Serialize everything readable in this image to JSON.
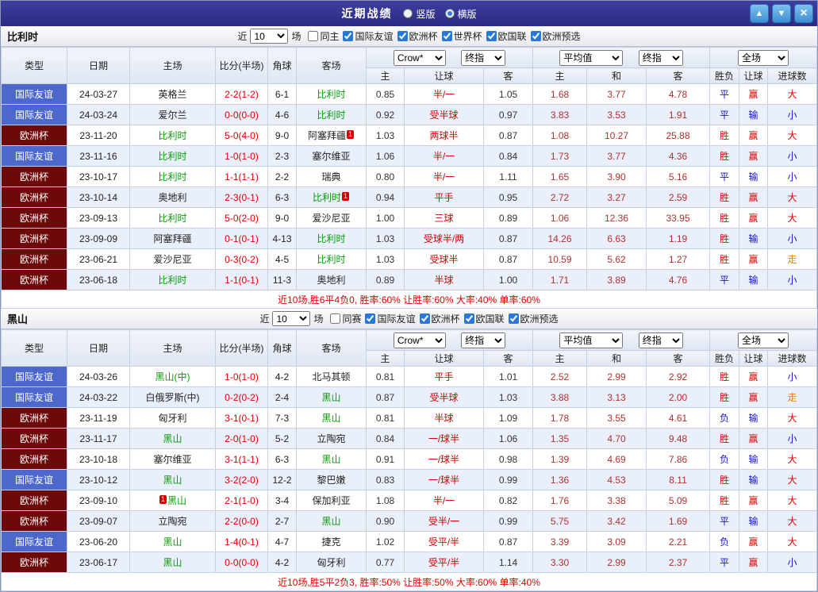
{
  "topbar": {
    "title": "近期战绩",
    "radios": [
      {
        "label": "竖版",
        "selected": false
      },
      {
        "label": "横版",
        "selected": true
      }
    ],
    "up_icon": "▲",
    "down_icon": "▼",
    "close_icon": "×"
  },
  "labels": {
    "near": "近",
    "games": "场"
  },
  "columns": {
    "type": "类型",
    "date": "日期",
    "home": "主场",
    "score": "比分(半场)",
    "corner": "角球",
    "away": "客场",
    "ah_home": "主",
    "ah_line": "让球",
    "ah_away": "客",
    "eu_home": "主",
    "eu_draw": "和",
    "eu_away": "客",
    "result": "胜负",
    "ah_result": "让球",
    "goals": "进球数"
  },
  "selects": {
    "bookmaker": "Crow*",
    "final_a": "终指",
    "average": "平均值",
    "final_b": "终指",
    "fulltime": "全场"
  },
  "colors": {
    "titlebar": "#32328e",
    "friendly_type": "#4d68cc",
    "eurocup_type": "#6e0909",
    "highlight_team_green": "#0a9b0a",
    "win_red": "#e00000",
    "lose_blue": "#1515cc",
    "push_orange": "#dd8800"
  },
  "sections": [
    {
      "team": "比利时",
      "count": "10",
      "filters": [
        {
          "label": "同主",
          "checked": false
        },
        {
          "label": "国际友谊",
          "checked": true
        },
        {
          "label": "欧洲杯",
          "checked": true
        },
        {
          "label": "世界杯",
          "checked": true
        },
        {
          "label": "欧国联",
          "checked": true
        },
        {
          "label": "欧洲预选",
          "checked": true
        }
      ],
      "rows": [
        {
          "type": "国际友谊",
          "type_cls": "friendly",
          "date": "24-03-27",
          "home": "英格兰",
          "home_hl": false,
          "score": "2-2(1-2)",
          "corner": "6-1",
          "away": "比利时",
          "away_hl": true,
          "ah": [
            "0.85",
            "半/一",
            "1.05"
          ],
          "eu": [
            "1.68",
            "3.77",
            "4.78"
          ],
          "res": [
            "平",
            "赢",
            "大"
          ]
        },
        {
          "type": "国际友谊",
          "type_cls": "friendly",
          "date": "24-03-24",
          "home": "爱尔兰",
          "home_hl": false,
          "score": "0-0(0-0)",
          "corner": "4-6",
          "away": "比利时",
          "away_hl": true,
          "ah": [
            "0.92",
            "受半球",
            "0.97"
          ],
          "eu": [
            "3.83",
            "3.53",
            "1.91"
          ],
          "res": [
            "平",
            "输",
            "小"
          ]
        },
        {
          "type": "欧洲杯",
          "type_cls": "euro",
          "date": "23-11-20",
          "home": "比利时",
          "home_hl": true,
          "score": "5-0(4-0)",
          "corner": "9-0",
          "away": "阿塞拜疆",
          "away_hl": false,
          "away_badge": "1",
          "away_badge_pos": "post",
          "ah": [
            "1.03",
            "两球半",
            "0.87"
          ],
          "eu": [
            "1.08",
            "10.27",
            "25.88"
          ],
          "res": [
            "胜",
            "赢",
            "大"
          ]
        },
        {
          "type": "国际友谊",
          "type_cls": "friendly",
          "date": "23-11-16",
          "home": "比利时",
          "home_hl": true,
          "score": "1-0(1-0)",
          "corner": "2-3",
          "away": "塞尔维亚",
          "away_hl": false,
          "ah": [
            "1.06",
            "半/一",
            "0.84"
          ],
          "eu": [
            "1.73",
            "3.77",
            "4.36"
          ],
          "res": [
            "胜",
            "赢",
            "小"
          ]
        },
        {
          "type": "欧洲杯",
          "type_cls": "euro",
          "date": "23-10-17",
          "home": "比利时",
          "home_hl": true,
          "score": "1-1(1-1)",
          "corner": "2-2",
          "away": "瑞典",
          "away_hl": false,
          "ah": [
            "0.80",
            "半/一",
            "1.11"
          ],
          "eu": [
            "1.65",
            "3.90",
            "5.16"
          ],
          "res": [
            "平",
            "输",
            "小"
          ]
        },
        {
          "type": "欧洲杯",
          "type_cls": "euro",
          "date": "23-10-14",
          "home": "奥地利",
          "home_hl": false,
          "score": "2-3(0-1)",
          "corner": "6-3",
          "away": "比利时",
          "away_hl": true,
          "away_badge": "1",
          "away_badge_pos": "post",
          "ah": [
            "0.94",
            "平手",
            "0.95"
          ],
          "eu": [
            "2.72",
            "3.27",
            "2.59"
          ],
          "res": [
            "胜",
            "赢",
            "大"
          ]
        },
        {
          "type": "欧洲杯",
          "type_cls": "euro",
          "date": "23-09-13",
          "home": "比利时",
          "home_hl": true,
          "score": "5-0(2-0)",
          "corner": "9-0",
          "away": "爱沙尼亚",
          "away_hl": false,
          "ah": [
            "1.00",
            "三球",
            "0.89"
          ],
          "eu": [
            "1.06",
            "12.36",
            "33.95"
          ],
          "res": [
            "胜",
            "赢",
            "大"
          ]
        },
        {
          "type": "欧洲杯",
          "type_cls": "euro",
          "date": "23-09-09",
          "home": "阿塞拜疆",
          "home_hl": false,
          "score": "0-1(0-1)",
          "corner": "4-13",
          "away": "比利时",
          "away_hl": true,
          "ah": [
            "1.03",
            "受球半/两",
            "0.87"
          ],
          "eu": [
            "14.26",
            "6.63",
            "1.19"
          ],
          "res": [
            "胜",
            "输",
            "小"
          ]
        },
        {
          "type": "欧洲杯",
          "type_cls": "euro",
          "date": "23-06-21",
          "home": "爱沙尼亚",
          "home_hl": false,
          "score": "0-3(0-2)",
          "corner": "4-5",
          "away": "比利时",
          "away_hl": true,
          "ah": [
            "1.03",
            "受球半",
            "0.87"
          ],
          "eu": [
            "10.59",
            "5.62",
            "1.27"
          ],
          "res": [
            "胜",
            "赢",
            "走"
          ]
        },
        {
          "type": "欧洲杯",
          "type_cls": "euro",
          "date": "23-06-18",
          "home": "比利时",
          "home_hl": true,
          "score": "1-1(0-1)",
          "corner": "11-3",
          "away": "奥地利",
          "away_hl": false,
          "ah": [
            "0.89",
            "半球",
            "1.00"
          ],
          "eu": [
            "1.71",
            "3.89",
            "4.76"
          ],
          "res": [
            "平",
            "输",
            "小"
          ]
        }
      ],
      "summary": "近10场,胜6平4负0, 胜率:60% 让胜率:60% 大率:40% 单率:60%"
    },
    {
      "team": "黑山",
      "count": "10",
      "filters": [
        {
          "label": "同赛",
          "checked": false
        },
        {
          "label": "国际友谊",
          "checked": true
        },
        {
          "label": "欧洲杯",
          "checked": true
        },
        {
          "label": "欧国联",
          "checked": true
        },
        {
          "label": "欧洲预选",
          "checked": true
        }
      ],
      "rows": [
        {
          "type": "国际友谊",
          "type_cls": "friendly",
          "date": "24-03-26",
          "home": "黑山(中)",
          "home_hl": true,
          "score": "1-0(1-0)",
          "corner": "4-2",
          "away": "北马其顿",
          "away_hl": false,
          "ah": [
            "0.81",
            "平手",
            "1.01"
          ],
          "eu": [
            "2.52",
            "2.99",
            "2.92"
          ],
          "res": [
            "胜",
            "赢",
            "小"
          ]
        },
        {
          "type": "国际友谊",
          "type_cls": "friendly",
          "date": "24-03-22",
          "home": "白俄罗斯(中)",
          "home_hl": false,
          "score": "0-2(0-2)",
          "corner": "2-4",
          "away": "黑山",
          "away_hl": true,
          "ah": [
            "0.87",
            "受半球",
            "1.03"
          ],
          "eu": [
            "3.88",
            "3.13",
            "2.00"
          ],
          "res": [
            "胜",
            "赢",
            "走"
          ]
        },
        {
          "type": "欧洲杯",
          "type_cls": "euro",
          "date": "23-11-19",
          "home": "匈牙利",
          "home_hl": false,
          "score": "3-1(0-1)",
          "corner": "7-3",
          "away": "黑山",
          "away_hl": true,
          "ah": [
            "0.81",
            "半球",
            "1.09"
          ],
          "eu": [
            "1.78",
            "3.55",
            "4.61"
          ],
          "res": [
            "负",
            "输",
            "大"
          ]
        },
        {
          "type": "欧洲杯",
          "type_cls": "euro",
          "date": "23-11-17",
          "home": "黑山",
          "home_hl": true,
          "score": "2-0(1-0)",
          "corner": "5-2",
          "away": "立陶宛",
          "away_hl": false,
          "ah": [
            "0.84",
            "一/球半",
            "1.06"
          ],
          "eu": [
            "1.35",
            "4.70",
            "9.48"
          ],
          "res": [
            "胜",
            "赢",
            "小"
          ]
        },
        {
          "type": "欧洲杯",
          "type_cls": "euro",
          "date": "23-10-18",
          "home": "塞尔维亚",
          "home_hl": false,
          "score": "3-1(1-1)",
          "corner": "6-3",
          "away": "黑山",
          "away_hl": true,
          "ah": [
            "0.91",
            "一/球半",
            "0.98"
          ],
          "eu": [
            "1.39",
            "4.69",
            "7.86"
          ],
          "res": [
            "负",
            "输",
            "大"
          ]
        },
        {
          "type": "国际友谊",
          "type_cls": "friendly",
          "date": "23-10-12",
          "home": "黑山",
          "home_hl": true,
          "score": "3-2(2-0)",
          "corner": "12-2",
          "away": "黎巴嫩",
          "away_hl": false,
          "ah": [
            "0.83",
            "一/球半",
            "0.99"
          ],
          "eu": [
            "1.36",
            "4.53",
            "8.11"
          ],
          "res": [
            "胜",
            "输",
            "大"
          ]
        },
        {
          "type": "欧洲杯",
          "type_cls": "euro",
          "date": "23-09-10",
          "home": "黑山",
          "home_hl": true,
          "home_badge": "1",
          "home_badge_pos": "pre",
          "score": "2-1(1-0)",
          "corner": "3-4",
          "away": "保加利亚",
          "away_hl": false,
          "ah": [
            "1.08",
            "半/一",
            "0.82"
          ],
          "eu": [
            "1.76",
            "3.38",
            "5.09"
          ],
          "res": [
            "胜",
            "赢",
            "大"
          ]
        },
        {
          "type": "欧洲杯",
          "type_cls": "euro",
          "date": "23-09-07",
          "home": "立陶宛",
          "home_hl": false,
          "score": "2-2(0-0)",
          "corner": "2-7",
          "away": "黑山",
          "away_hl": true,
          "ah": [
            "0.90",
            "受半/一",
            "0.99"
          ],
          "eu": [
            "5.75",
            "3.42",
            "1.69"
          ],
          "res": [
            "平",
            "输",
            "大"
          ]
        },
        {
          "type": "国际友谊",
          "type_cls": "friendly",
          "date": "23-06-20",
          "home": "黑山",
          "home_hl": true,
          "score": "1-4(0-1)",
          "corner": "4-7",
          "away": "捷克",
          "away_hl": false,
          "ah": [
            "1.02",
            "受平/半",
            "0.87"
          ],
          "eu": [
            "3.39",
            "3.09",
            "2.21"
          ],
          "res": [
            "负",
            "赢",
            "大"
          ]
        },
        {
          "type": "欧洲杯",
          "type_cls": "euro",
          "date": "23-06-17",
          "home": "黑山",
          "home_hl": true,
          "score": "0-0(0-0)",
          "corner": "4-2",
          "away": "匈牙利",
          "away_hl": false,
          "ah": [
            "0.77",
            "受平/半",
            "1.14"
          ],
          "eu": [
            "3.30",
            "2.99",
            "2.37"
          ],
          "res": [
            "平",
            "赢",
            "小"
          ]
        }
      ],
      "summary": "近10场,胜5平2负3, 胜率:50% 让胜率:50% 大率:60% 单率:40%"
    }
  ]
}
